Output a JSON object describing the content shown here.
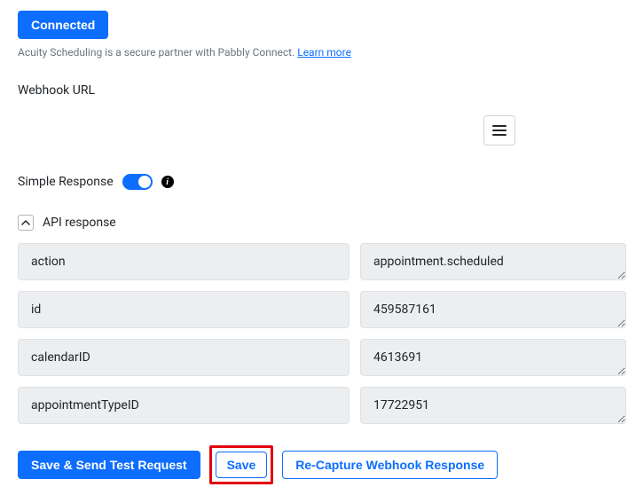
{
  "header": {
    "connected_label": "Connected",
    "helper_pre": "Acuity Scheduling is a secure partner with Pabbly Connect. ",
    "learn_more": "Learn more"
  },
  "webhook": {
    "label": "Webhook URL"
  },
  "simple_response": {
    "label": "Simple Response",
    "state": true
  },
  "api_response": {
    "header": "API response",
    "rows": [
      {
        "key": "action",
        "value": "appointment.scheduled"
      },
      {
        "key": "id",
        "value": "459587161"
      },
      {
        "key": "calendarID",
        "value": "4613691"
      },
      {
        "key": "appointmentTypeID",
        "value": "17722951"
      }
    ]
  },
  "buttons": {
    "save_send": "Save & Send Test Request",
    "save": "Save",
    "recapture": "Re-Capture Webhook Response"
  }
}
